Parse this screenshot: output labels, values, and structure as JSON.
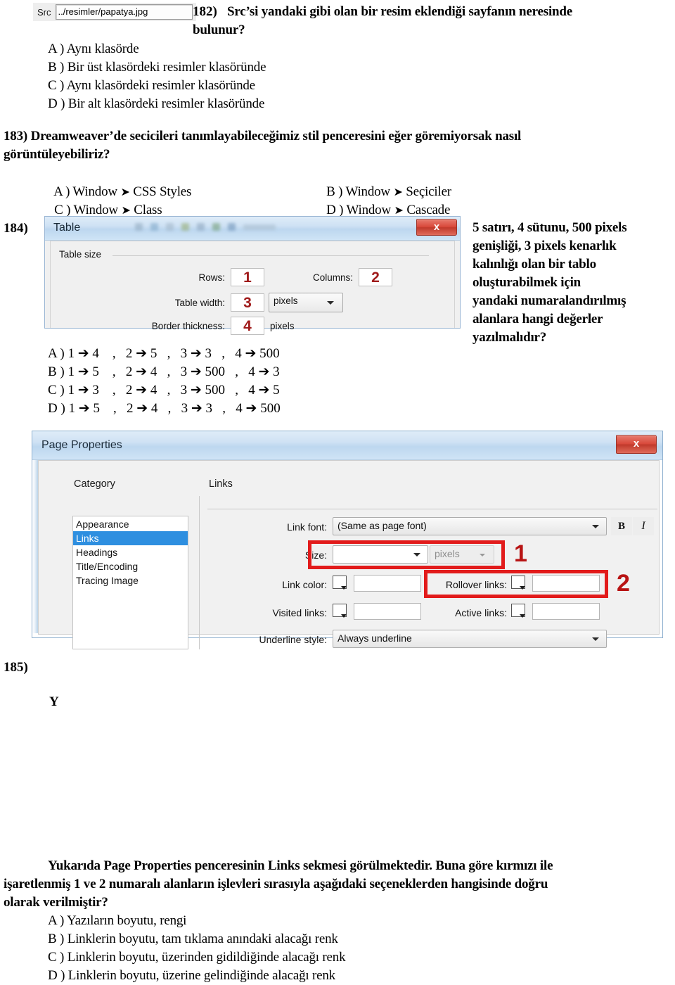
{
  "src_widget": {
    "label": "Src",
    "value": "../resimler/papatya.jpg"
  },
  "q182": {
    "number": "182)",
    "stem_line1": "Src’si yandaki gibi olan bir resim eklendiği sayfanın neresinde",
    "stem_line2": "bulunur?",
    "options": [
      "A ) Aynı klasörde",
      "B ) Bir üst klasördeki resimler klasöründe",
      "C ) Aynı klasördeki resimler klasöründe",
      "D ) Bir alt klasördeki resimler klasöründe"
    ]
  },
  "q183": {
    "stem_line1": "183) Dreamweaver’de secicileri tanımlayabileceğimiz stil penceresini eğer göremiyorsak nasıl",
    "stem_line2": "görüntüleyebiliriz?",
    "optA_pre": "A ) Window ",
    "optA_post": " CSS Styles",
    "optB_pre": "B ) Window ",
    "optB_post": " Seçiciler",
    "optC_pre": "C ) Window ",
    "optC_post": " Class",
    "optD_pre": "D ) Window ",
    "optD_post": " Cascade"
  },
  "q184": {
    "number": "184)",
    "side_text_lines": [
      "5 satırı, 4 sütunu, 500 pixels",
      "genişliği, 3 pixels kenarlık",
      "kalınlığı olan bir tablo",
      "oluşturabilmek için",
      "yandaki numaralandırılmış",
      "alanlara hangi değerler",
      "yazılmalıdır?"
    ],
    "options": [
      {
        "letter": "A )",
        "pairs": [
          {
            "from": "1",
            "to": "4"
          },
          {
            "from": "2",
            "to": "5"
          },
          {
            "from": "3",
            "to": "3"
          },
          {
            "from": "4",
            "to": "500"
          }
        ]
      },
      {
        "letter": "B )",
        "pairs": [
          {
            "from": "1",
            "to": "5"
          },
          {
            "from": "2",
            "to": "4"
          },
          {
            "from": "3",
            "to": "500"
          },
          {
            "from": "4",
            "to": "3"
          }
        ]
      },
      {
        "letter": "C )",
        "pairs": [
          {
            "from": "1",
            "to": "3"
          },
          {
            "from": "2",
            "to": "4"
          },
          {
            "from": "3",
            "to": "500"
          },
          {
            "from": "4",
            "to": "5"
          }
        ]
      },
      {
        "letter": "D )",
        "pairs": [
          {
            "from": "1",
            "to": "5"
          },
          {
            "from": "2",
            "to": "4"
          },
          {
            "from": "3",
            "to": "3"
          },
          {
            "from": "4",
            "to": "500"
          }
        ]
      }
    ],
    "opt_a_text": "A ) 1 ➔ 4    ,   2 ➔ 5   ,   3 ➔ 3   ,   4 ➔ 500",
    "opt_b_text": "B ) 1 ➔ 5    ,   2 ➔ 4   ,   3 ➔ 500   ,   4 ➔ 3",
    "opt_c_text": "C ) 1 ➔ 3    ,   2 ➔ 4   ,   3 ➔ 500   ,   4 ➔ 5",
    "opt_d_text": "D ) 1 ➔ 5    ,   2 ➔ 4   ,   3 ➔ 3   ,   4 ➔ 500"
  },
  "table_dialog": {
    "title": "Table",
    "close_label": "x",
    "group_title": "Table size",
    "rows_label": "Rows:",
    "rows_value": "1",
    "columns_label": "Columns:",
    "columns_value": "2",
    "table_width_label": "Table width:",
    "table_width_value": "3",
    "width_unit_value": "pixels",
    "border_thickness_label": "Border thickness:",
    "border_thickness_value": "4",
    "border_unit_text": "pixels"
  },
  "page_properties": {
    "title": "Page Properties",
    "close_label": "x",
    "category_heading": "Category",
    "section_heading": "Links",
    "categories": [
      {
        "label": "Appearance",
        "selected": false
      },
      {
        "label": "Links",
        "selected": true
      },
      {
        "label": "Headings",
        "selected": false
      },
      {
        "label": "Title/Encoding",
        "selected": false
      },
      {
        "label": "Tracing Image",
        "selected": false
      }
    ],
    "link_font_label": "Link font:",
    "link_font_value": "(Same as page font)",
    "bold_label": "B",
    "italic_label": "I",
    "size_label": "Size:",
    "size_value": "",
    "size_unit_value": "pixels",
    "link_color_label": "Link color:",
    "link_color_value": "",
    "rollover_links_label": "Rollover links:",
    "rollover_links_value": "",
    "visited_links_label": "Visited links:",
    "visited_links_value": "",
    "active_links_label": "Active links:",
    "active_links_value": "",
    "underline_style_label": "Underline style:",
    "underline_style_value": "Always underline",
    "marker_1": "1",
    "marker_2": "2"
  },
  "q185": {
    "number": "185)",
    "letter_mark": "Y",
    "stem_line1": "Yukarıda Page Properties penceresinin Links sekmesi görülmektedir. Buna göre kırmızı ile",
    "stem_line2": "işaretlenmiş 1 ve 2 numaralı alanların işlevleri sırasıyla aşağıdaki seçeneklerden hangisinde doğru",
    "stem_line3": "olarak verilmiştir?",
    "options": [
      "A ) Yazıların boyutu, rengi",
      "B ) Linklerin boyutu, tam tıklama anındaki alacağı renk",
      "C ) Linklerin boyutu, üzerinden gidildiğinde alacağı renk",
      "D ) Linklerin boyutu, üzerine gelindiğinde alacağı renk"
    ]
  },
  "colors": {
    "marker_red": "#b81414",
    "redbox_border": "#e21b1b",
    "selection_blue": "#2e8fe0",
    "close_red": "#c0392b"
  }
}
